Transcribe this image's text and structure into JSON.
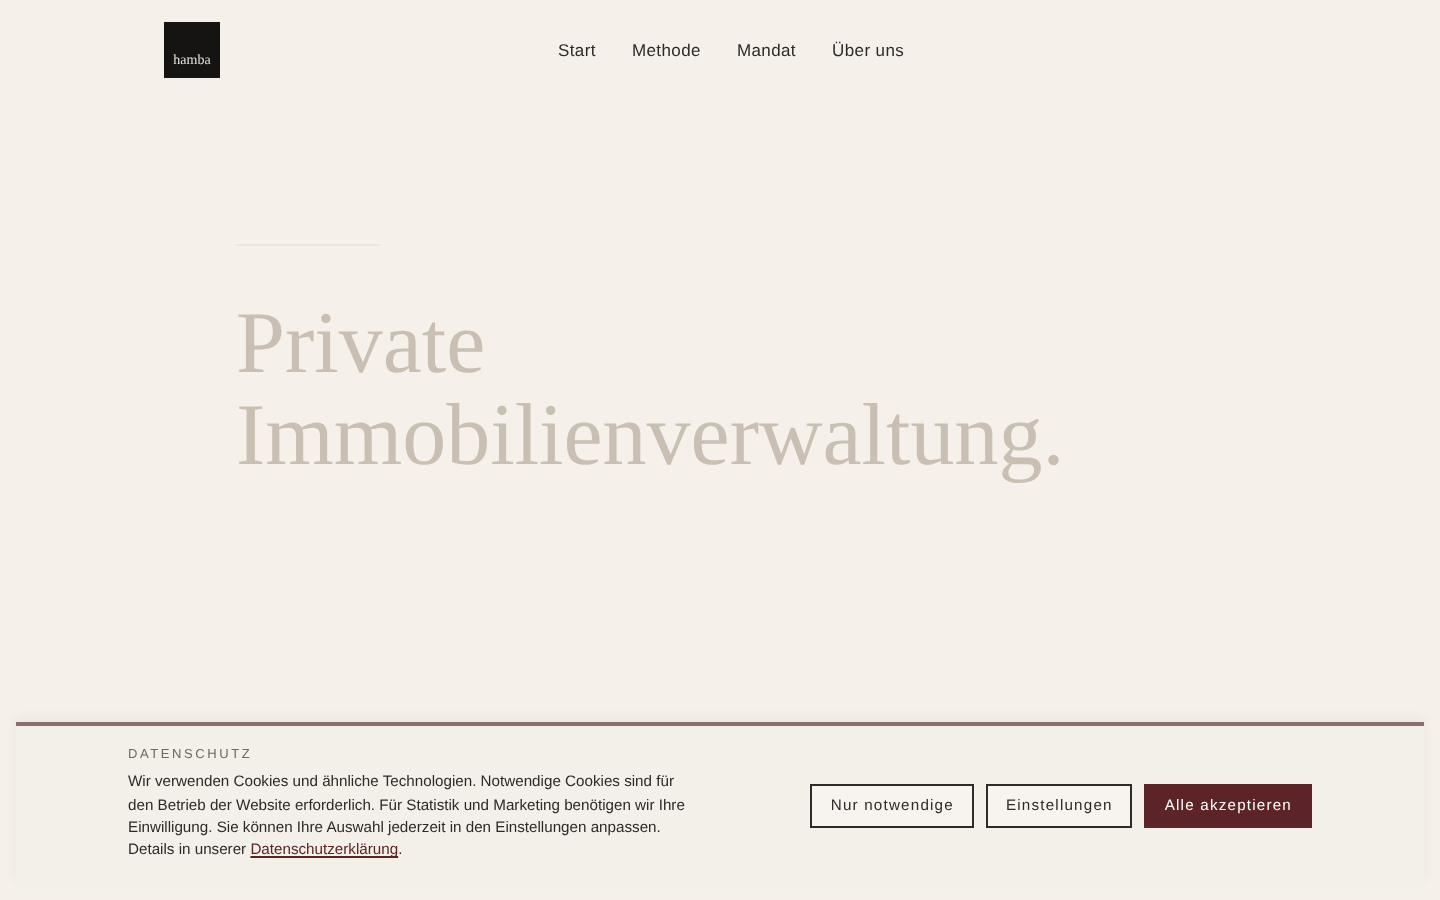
{
  "header": {
    "logo": "hamba",
    "nav": [
      {
        "label": "Start"
      },
      {
        "label": "Methode"
      },
      {
        "label": "Mandat"
      },
      {
        "label": "Über uns"
      }
    ]
  },
  "hero": {
    "title_lines": [
      "Private",
      "Immobilienverwaltung."
    ]
  },
  "cookie_banner": {
    "heading": "DATENSCHUTZ",
    "text": "Wir verwenden Cookies und ähnliche Technologien. Notwendige Cookies sind für den Betrieb der Website erforderlich. Für Statistik und Marketing benötigen wir Ihre Einwilligung. Sie können Ihre Auswahl jederzeit in den Einstellungen anpassen. Details in unserer ",
    "link": "Datenschutzerklärung",
    "text_end": ".",
    "buttons": [
      {
        "label": "Nur notwendige",
        "kind": "outline"
      },
      {
        "label": "Einstellungen",
        "kind": "outline"
      },
      {
        "label": "Alle akzeptieren",
        "kind": "primary"
      }
    ]
  }
}
